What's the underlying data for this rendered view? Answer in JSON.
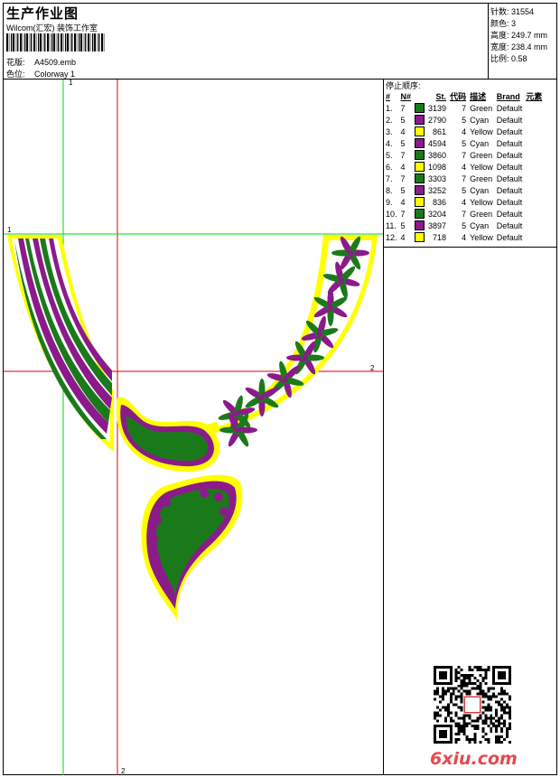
{
  "header": {
    "title": "生产作业图",
    "company": "Wilcom(汇宏)  装饰工作室",
    "design_label": "花版:",
    "design_value": "A4509.emb",
    "colorway_label": "色位:",
    "colorway_value": "Colorway 1"
  },
  "stats": [
    {
      "label": "针数:",
      "value": "31554"
    },
    {
      "label": "颜色:",
      "value": "3"
    },
    {
      "label": "高度:",
      "value": "249.7 mm"
    },
    {
      "label": "宽度:",
      "value": "238.4 mm"
    },
    {
      "label": "比例:",
      "value": "0.58"
    }
  ],
  "stop_sequence": {
    "title": "停止顺序:",
    "headers": [
      "#",
      "N#",
      "St.",
      "代码",
      "描述",
      "Brand",
      "元素"
    ],
    "rows": [
      {
        "n": "1.",
        "needle": "7",
        "color": "#1a7a1a",
        "st": "3139",
        "code": "7",
        "desc": "Green",
        "brand": "Default"
      },
      {
        "n": "2.",
        "needle": "5",
        "color": "#8b1a8b",
        "st": "2790",
        "code": "5",
        "desc": "Cyan",
        "brand": "Default"
      },
      {
        "n": "3.",
        "needle": "4",
        "color": "#ffff00",
        "st": "861",
        "code": "4",
        "desc": "Yellow",
        "brand": "Default"
      },
      {
        "n": "4.",
        "needle": "5",
        "color": "#8b1a8b",
        "st": "4594",
        "code": "5",
        "desc": "Cyan",
        "brand": "Default"
      },
      {
        "n": "5.",
        "needle": "7",
        "color": "#1a7a1a",
        "st": "3860",
        "code": "7",
        "desc": "Green",
        "brand": "Default"
      },
      {
        "n": "6.",
        "needle": "4",
        "color": "#ffff00",
        "st": "1098",
        "code": "4",
        "desc": "Yellow",
        "brand": "Default"
      },
      {
        "n": "7.",
        "needle": "7",
        "color": "#1a7a1a",
        "st": "3303",
        "code": "7",
        "desc": "Green",
        "brand": "Default"
      },
      {
        "n": "8.",
        "needle": "5",
        "color": "#8b1a8b",
        "st": "3252",
        "code": "5",
        "desc": "Cyan",
        "brand": "Default"
      },
      {
        "n": "9.",
        "needle": "4",
        "color": "#ffff00",
        "st": "836",
        "code": "4",
        "desc": "Yellow",
        "brand": "Default"
      },
      {
        "n": "10.",
        "needle": "7",
        "color": "#1a7a1a",
        "st": "3204",
        "code": "7",
        "desc": "Green",
        "brand": "Default"
      },
      {
        "n": "11.",
        "needle": "5",
        "color": "#8b1a8b",
        "st": "3897",
        "code": "5",
        "desc": "Cyan",
        "brand": "Default"
      },
      {
        "n": "12.",
        "needle": "4",
        "color": "#ffff00",
        "st": "718",
        "code": "4",
        "desc": "Yellow",
        "brand": "Default"
      }
    ]
  },
  "guides": {
    "v1_label": "1",
    "v2_label": "2",
    "h1_label": "1",
    "h2_label": "2"
  },
  "watermark": "6xiu.com",
  "colors": {
    "green": "#1a7a1a",
    "purple": "#8b1a8b",
    "yellow": "#ffff00",
    "guide_green": "#00dd00",
    "guide_red": "#dd0000"
  }
}
